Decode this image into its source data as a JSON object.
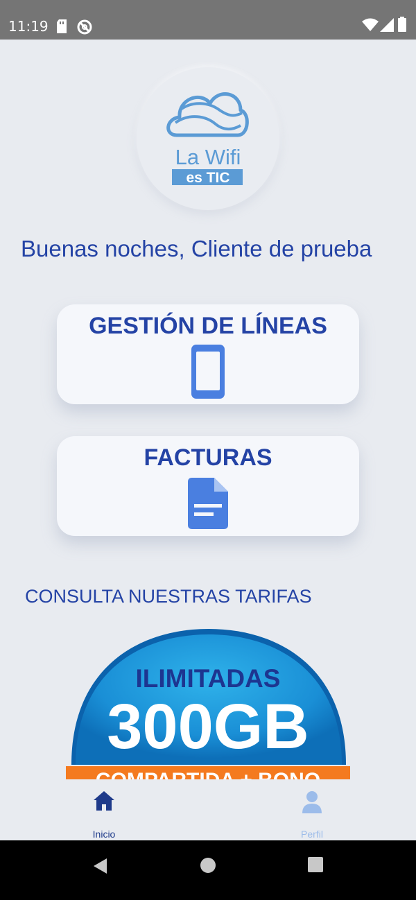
{
  "status_bar": {
    "time": "11:19",
    "icons": [
      "sd-card-icon",
      "do-not-disturb-icon",
      "wifi-icon",
      "signal-icon",
      "battery-icon"
    ]
  },
  "logo": {
    "line1": "La Wifi",
    "line2": "es TIC",
    "color": "#5b9bd5"
  },
  "greeting": "Buenas noches, Cliente de prueba",
  "menu": {
    "lines_label": "GESTIÓN DE LÍNEAS",
    "lines_icon": "smartphone-icon",
    "bills_label": "FACTURAS",
    "bills_icon": "document-icon"
  },
  "tariffs": {
    "section_title": "CONSULTA NUESTRAS TARIFAS",
    "banner_line1": "ILIMITADAS",
    "banner_line2": "300GB",
    "banner_line3": "COMPARTIDA + BONO"
  },
  "bottom_nav": {
    "home_label": "Inicio",
    "home_icon": "home-icon",
    "profile_label": "Perfil",
    "profile_icon": "user-icon"
  },
  "colors": {
    "primary": "#2443a5",
    "icon_blue": "#4a7fe0",
    "background": "#e8ebf0",
    "card": "#f5f7fb",
    "banner_orange": "#f47a1f"
  }
}
